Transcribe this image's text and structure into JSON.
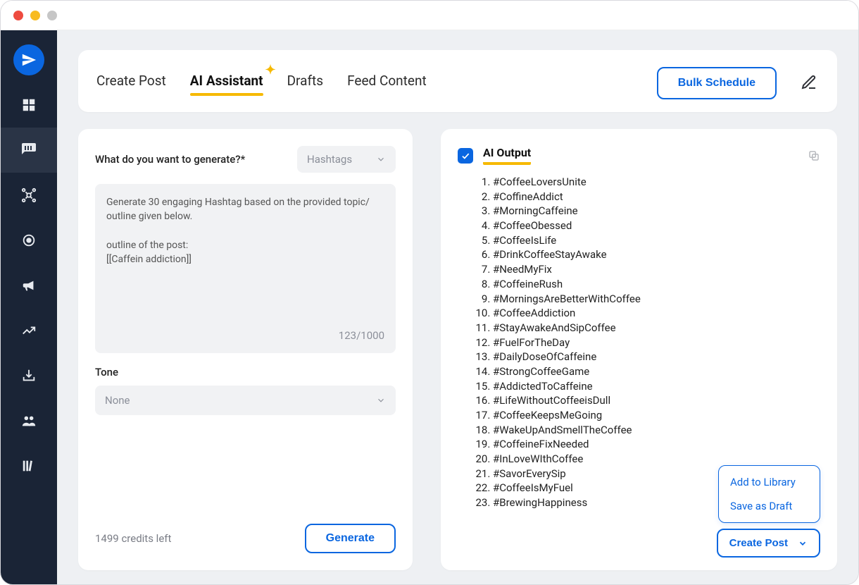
{
  "tabs": {
    "create_post": "Create Post",
    "ai_assistant": "AI Assistant",
    "drafts": "Drafts",
    "feed_content": "Feed Content"
  },
  "bulk_schedule_label": "Bulk Schedule",
  "left_panel": {
    "question_label": "What do you want to generate?*",
    "type_select_value": "Hashtags",
    "prompt_text": "Generate 30 engaging Hashtag based on the provided topic/ outline given below.\n\noutline of the post:\n[[Caffein addiction]]",
    "char_count": "123/1000",
    "tone_label": "Tone",
    "tone_value": "None",
    "credits_left": "1499 credits left",
    "generate_label": "Generate"
  },
  "right_panel": {
    "output_title": "AI Output",
    "hashtags": [
      "#CoffeeLoversUnite",
      "#CoffineAddict",
      "#MorningCaffeine",
      "#CoffeeObessed",
      "#CoffeeIsLife",
      "#DrinkCoffeeStayAwake",
      "#NeedMyFix",
      "#CoffeineRush",
      "#MorningsAreBetterWithCoffee",
      "#CoffeeAddiction",
      "#StayAwakeAndSipCoffee",
      "#FuelForTheDay",
      "#DailyDoseOfCaffeine",
      "#StrongCoffeeGame",
      "#AddictedToCaffeine",
      "#LifeWithoutCoffeeisDull",
      "#CoffeeKeepsMeGoing",
      "#WakeUpAndSmellTheCoffee",
      "#CoffeineFixNeeded",
      "#InLoveWIthCoffee",
      "#SavorEverySip",
      "#CoffeeIsMyFuel",
      "#BrewingHappiness"
    ],
    "menu": {
      "add_to_library": "Add to Library",
      "save_as_draft": "Save as Draft"
    },
    "create_post_label": "Create Post"
  }
}
